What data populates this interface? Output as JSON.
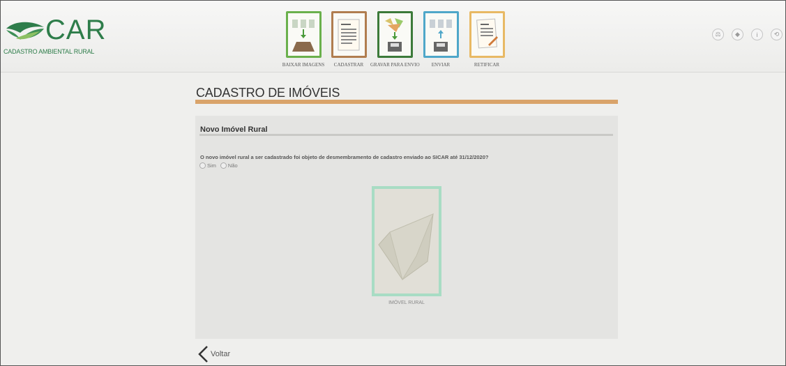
{
  "header": {
    "logo_text": "CAR",
    "logo_subtitle": "CADASTRO AMBIENTAL RURAL",
    "toolbar": [
      {
        "label": "BAIXAR IMAGENS",
        "color": "#6ab04c"
      },
      {
        "label": "CADASTRAR",
        "color": "#b07d4f"
      },
      {
        "label": "GRAVAR PARA ENVIO",
        "color": "#3c7a3a"
      },
      {
        "label": "ENVIAR",
        "color": "#4fa7c9"
      },
      {
        "label": "RETIFICAR",
        "color": "#e8b964"
      }
    ],
    "right_icons": [
      "scales-icon",
      "tag-icon",
      "info-icon",
      "refresh-icon"
    ]
  },
  "page": {
    "title": "CADASTRO DE IMÓVEIS",
    "accent_color": "#d9a36a"
  },
  "panel": {
    "heading": "Novo Imóvel Rural",
    "question": "O novo imóvel rural a ser cadastrado foi objeto de desmembramento de cadastro enviado ao SICAR até 31/12/2020?",
    "options": [
      "Sim",
      "Não"
    ],
    "card_label": "IMÓVEL RURAL"
  },
  "footer": {
    "back_label": "Voltar"
  }
}
